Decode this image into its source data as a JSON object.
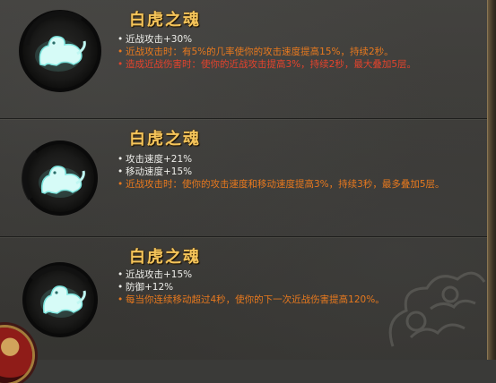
{
  "colors": {
    "title": "#f4c45a",
    "stat_text": "#eeeeea",
    "effect_orange": "#e8791e",
    "effect_red": "#e4432c",
    "icon_glow": "#a8f3ee"
  },
  "panels": [
    {
      "icon": "white-tiger-soul-icon",
      "title": "白虎之魂",
      "lines": [
        {
          "style": "white",
          "bullet": "•",
          "text": "近战攻击+30%"
        },
        {
          "style": "orange",
          "bullet": "•",
          "text": "近战攻击时：有5%的几率使你的攻击速度提高15%，持续2秒。"
        },
        {
          "style": "red",
          "bullet": "•",
          "text": "造成近战伤害时：使你的近战攻击提高3%，持续2秒，最大叠加5层。"
        }
      ]
    },
    {
      "icon": "white-tiger-soul-icon",
      "title": "白虎之魂",
      "lines": [
        {
          "style": "white",
          "bullet": "•",
          "text": "攻击速度+21%"
        },
        {
          "style": "white",
          "bullet": "•",
          "text": "移动速度+15%"
        },
        {
          "style": "orange",
          "bullet": "•",
          "text": "近战攻击时：使你的攻击速度和移动速度提高3%，持续3秒，最多叠加5层。"
        }
      ]
    },
    {
      "icon": "white-tiger-soul-icon",
      "title": "白虎之魂",
      "lines": [
        {
          "style": "white",
          "bullet": "•",
          "text": "近战攻击+15%"
        },
        {
          "style": "white",
          "bullet": "•",
          "text": "防御+12%"
        },
        {
          "style": "orange",
          "bullet": "•",
          "text": "每当你连续移动超过4秒，使你的下一次近战伤害提高120%。"
        }
      ]
    }
  ]
}
